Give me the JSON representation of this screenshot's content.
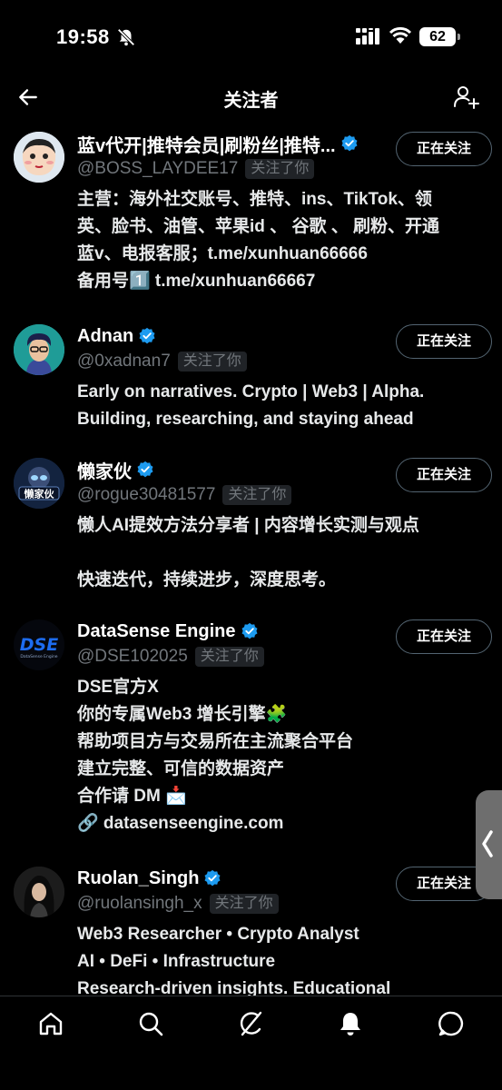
{
  "status_bar": {
    "time": "19:58",
    "battery": "62"
  },
  "header": {
    "title": "关注者"
  },
  "users": [
    {
      "name": "蓝v代开|推特会员|刷粉丝|推特...",
      "handle": "@BOSS_LAYDEE17",
      "follows_you": "关注了你",
      "button": "正在关注",
      "bio": [
        "主营：海外社交账号、推特、ins、TikTok、领",
        "英、脸书、油管、苹果id 、 谷歌 、 刷粉、开通",
        "蓝v、电报客服；t.me/xunhuan66666",
        "备用号1️⃣ t.me/xunhuan66667"
      ]
    },
    {
      "name": "Adnan",
      "handle": "@0xadnan7",
      "follows_you": "关注了你",
      "button": "正在关注",
      "bio": [
        "Early on narratives. Crypto | Web3 | Alpha.",
        "Building, researching, and staying ahead"
      ]
    },
    {
      "name": "懒家伙",
      "handle": "@rogue30481577",
      "follows_you": "关注了你",
      "button": "正在关注",
      "bio": [
        "懒人AI提效方法分享者 | 内容增长实测与观点",
        "",
        "快速迭代，持续进步，深度思考。"
      ]
    },
    {
      "name": "DataSense Engine",
      "handle": "@DSE102025",
      "follows_you": "关注了你",
      "button": "正在关注",
      "bio": [
        "DSE官方X",
        "你的专属Web3 增长引擎🧩",
        "帮助项目方与交易所在主流聚合平台",
        "建立完整、可信的数据资产",
        "合作请 DM 📩",
        "🔗 datasenseengine.com"
      ]
    },
    {
      "name": "Ruolan_Singh",
      "handle": "@ruolansingh_x",
      "follows_you": "关注了你",
      "button": "正在关注",
      "bio": [
        "Web3 Researcher • Crypto Analyst",
        "AI • DeFi • Infrastructure",
        "Research-driven insights. Educational"
      ]
    }
  ],
  "avatars": {
    "dse_text": "DSE",
    "dse_sub": "DataSense Engine",
    "lazy_text": "懒家伙"
  },
  "colors": {
    "verified": "#1d9bf0",
    "background": "#000000",
    "secondary_text": "#71767b"
  },
  "icons": [
    "back-arrow-icon",
    "add-user-icon",
    "verified-icon",
    "home-icon",
    "search-icon",
    "grok-icon",
    "bell-icon",
    "messages-icon",
    "mute-icon"
  ]
}
